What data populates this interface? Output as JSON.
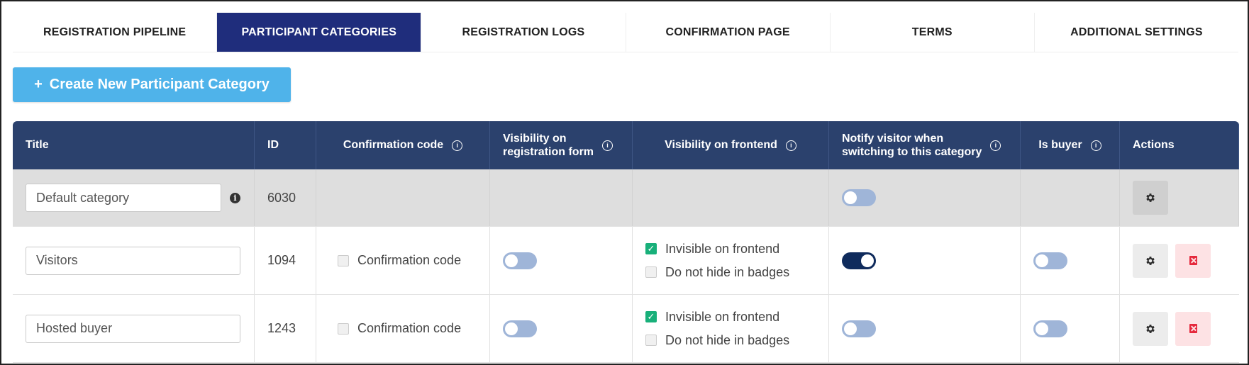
{
  "tabs": [
    {
      "label": "REGISTRATION PIPELINE",
      "active": false
    },
    {
      "label": "PARTICIPANT CATEGORIES",
      "active": true
    },
    {
      "label": "REGISTRATION LOGS",
      "active": false
    },
    {
      "label": "CONFIRMATION PAGE",
      "active": false
    },
    {
      "label": "TERMS",
      "active": false
    },
    {
      "label": "ADDITIONAL SETTINGS",
      "active": false
    }
  ],
  "create_button": {
    "icon": "+",
    "label": "Create New Participant Category"
  },
  "table": {
    "headers": {
      "title": "Title",
      "id": "ID",
      "confirmation_code": "Confirmation code",
      "visibility_registration_line1": "Visibility on",
      "visibility_registration_line2": "registration form",
      "visibility_frontend": "Visibility on frontend",
      "notify_line1": "Notify visitor when",
      "notify_line2": "switching to this category",
      "is_buyer": "Is buyer",
      "actions": "Actions"
    },
    "rows": [
      {
        "title": "Default category",
        "id": "6030",
        "notify": false
      },
      {
        "title": "Visitors",
        "id": "1094",
        "confirmation_code_label": "Confirmation code",
        "confirmation_code_checked": false,
        "visibility_registration": false,
        "invisible_on_frontend_label": "Invisible on frontend",
        "invisible_on_frontend": true,
        "do_not_hide_badges_label": "Do not hide in badges",
        "do_not_hide_badges": false,
        "notify": true,
        "is_buyer": false
      },
      {
        "title": "Hosted buyer",
        "id": "1243",
        "confirmation_code_label": "Confirmation code",
        "confirmation_code_checked": false,
        "visibility_registration": false,
        "invisible_on_frontend_label": "Invisible on frontend",
        "invisible_on_frontend": true,
        "do_not_hide_badges_label": "Do not hide in badges",
        "do_not_hide_badges": false,
        "notify": false,
        "is_buyer": false
      }
    ]
  },
  "colors": {
    "tab_active_bg": "#1f2d7c",
    "create_button_bg": "#4fb3ea",
    "table_header_bg": "#2b416d",
    "checkbox_on": "#18b07a",
    "toggle_on": "#0f2b5c",
    "toggle_off": "#9fb5d8",
    "delete_icon": "#e5283c"
  },
  "icons": {
    "info_outline": "info-circle-outline-icon",
    "info_solid": "info-circle-solid-icon",
    "gear": "gear-icon",
    "delete": "delete-icon"
  }
}
